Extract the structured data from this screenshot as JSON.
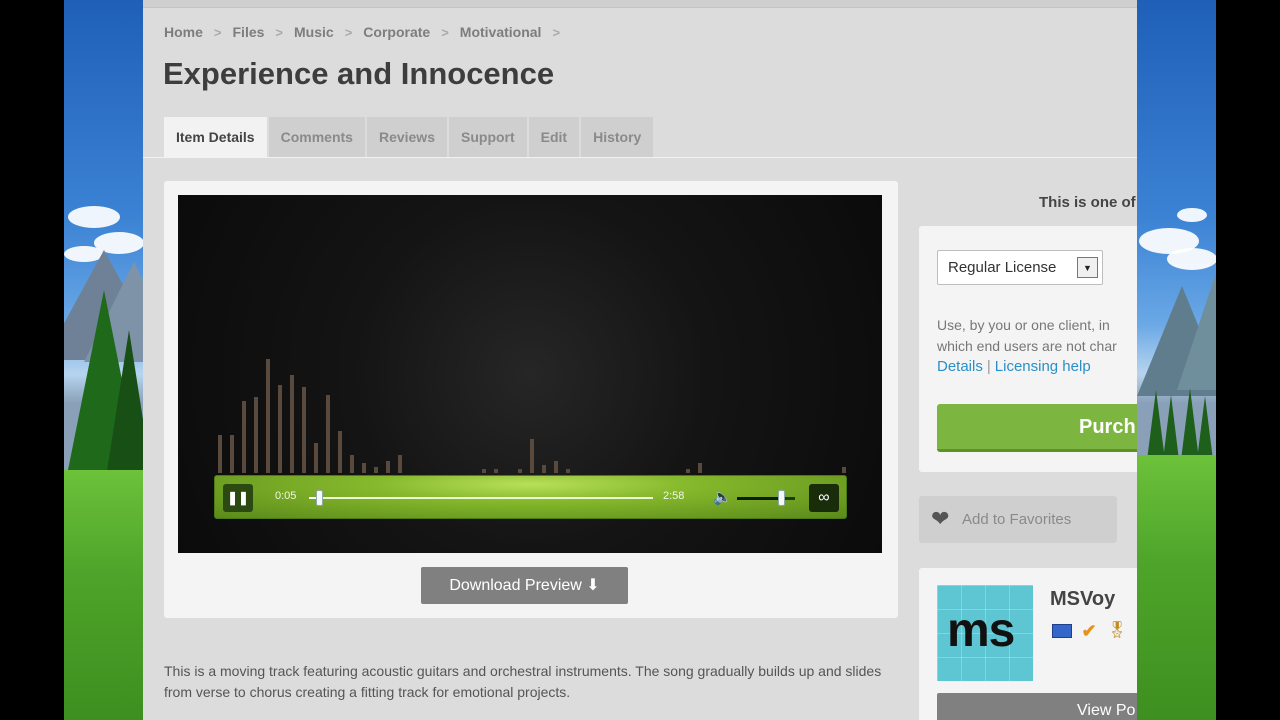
{
  "breadcrumb": [
    "Home",
    "Files",
    "Music",
    "Corporate",
    "Motivational"
  ],
  "page_title": "Experience and Innocence",
  "tabs": [
    {
      "label": "Item Details",
      "active": true
    },
    {
      "label": "Comments",
      "active": false
    },
    {
      "label": "Reviews",
      "active": false
    },
    {
      "label": "Support",
      "active": false
    },
    {
      "label": "Edit",
      "active": false
    },
    {
      "label": "History",
      "active": false
    }
  ],
  "player": {
    "pause_icon": "pause-icon",
    "current_time": "0:05",
    "duration": "2:58",
    "progress_fraction": 0.03,
    "volume_fraction": 0.75,
    "loop_icon": "loop-icon",
    "speaker_icon": "speaker-icon"
  },
  "download_button": "Download Preview",
  "description": "This is a moving track featuring acoustic guitars and orchestral instruments. The song gradually builds up and slides from verse to chorus creating a fitting track for emotional projects.",
  "sidebar": {
    "note": "This is one of",
    "license_select": "Regular License",
    "license_desc_line1": "Use, by you or one client, in",
    "license_desc_line2": "which end users are not char",
    "details_link": "Details",
    "licensing_help_link": "Licensing help",
    "purchase_button": "Purch",
    "favorites_label": "Add to Favorites",
    "author_name": "MSVoy",
    "avatar_text": "ms",
    "view_button": "View Po"
  },
  "colors": {
    "accent_green": "#7cb540",
    "link_blue": "#2a8fc8",
    "avatar_teal": "#5ec6d2"
  }
}
